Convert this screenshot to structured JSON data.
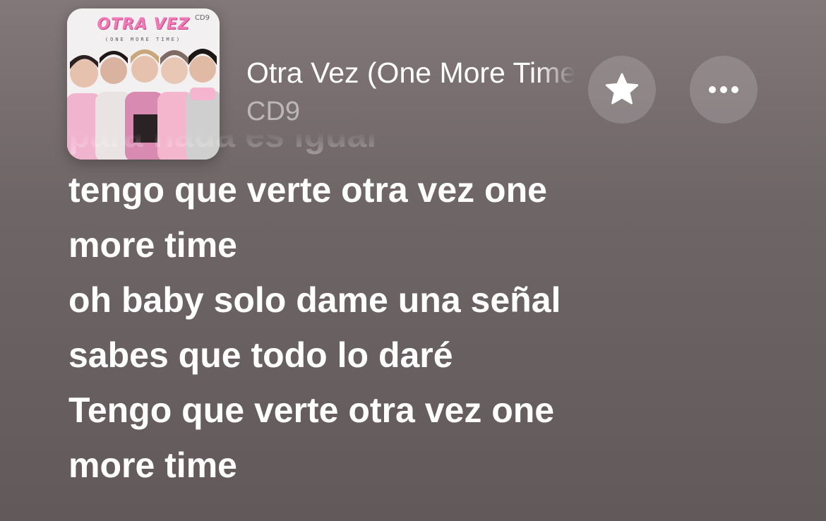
{
  "now_playing": {
    "title": "Otra Vez (One More Time)",
    "artist": "CD9",
    "album_art": {
      "title": "OTRA VEZ",
      "subtitle": "(ONE MORE TIME)",
      "logo": "CD9"
    }
  },
  "actions": {
    "favorite_icon": "star-icon",
    "more_icon": "ellipsis-icon"
  },
  "lyrics": [
    "para nada es igual",
    "tengo que verte otra vez one",
    "more time",
    "oh baby solo dame una señal",
    "sabes que todo lo daré",
    "Tengo que verte otra vez one",
    "more time"
  ],
  "colors": {
    "background": "#6e6566",
    "text_primary": "#ffffff",
    "art_accent": "#f07bb7"
  }
}
